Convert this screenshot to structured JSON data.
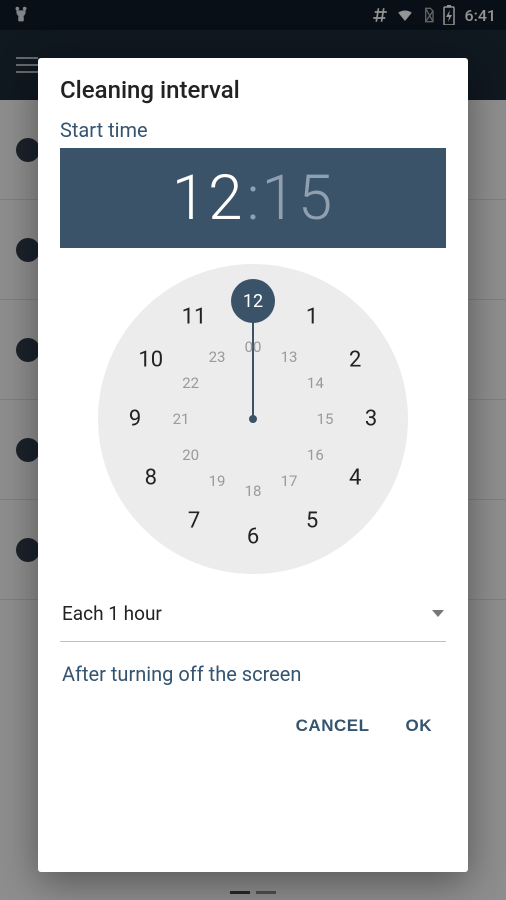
{
  "status": {
    "time": "6:41"
  },
  "dialog": {
    "title": "Cleaning interval",
    "start_label": "Start time",
    "hours": "12",
    "minutes": "15",
    "selected_outer": "12",
    "clock_outer": [
      "12",
      "1",
      "2",
      "3",
      "4",
      "5",
      "6",
      "7",
      "8",
      "9",
      "10",
      "11"
    ],
    "clock_inner": [
      "00",
      "13",
      "14",
      "15",
      "16",
      "17",
      "18",
      "19",
      "20",
      "21",
      "22",
      "23"
    ],
    "interval_value": "Each 1 hour",
    "option_label": "After turning off the screen",
    "cancel": "CANCEL",
    "ok": "OK"
  }
}
